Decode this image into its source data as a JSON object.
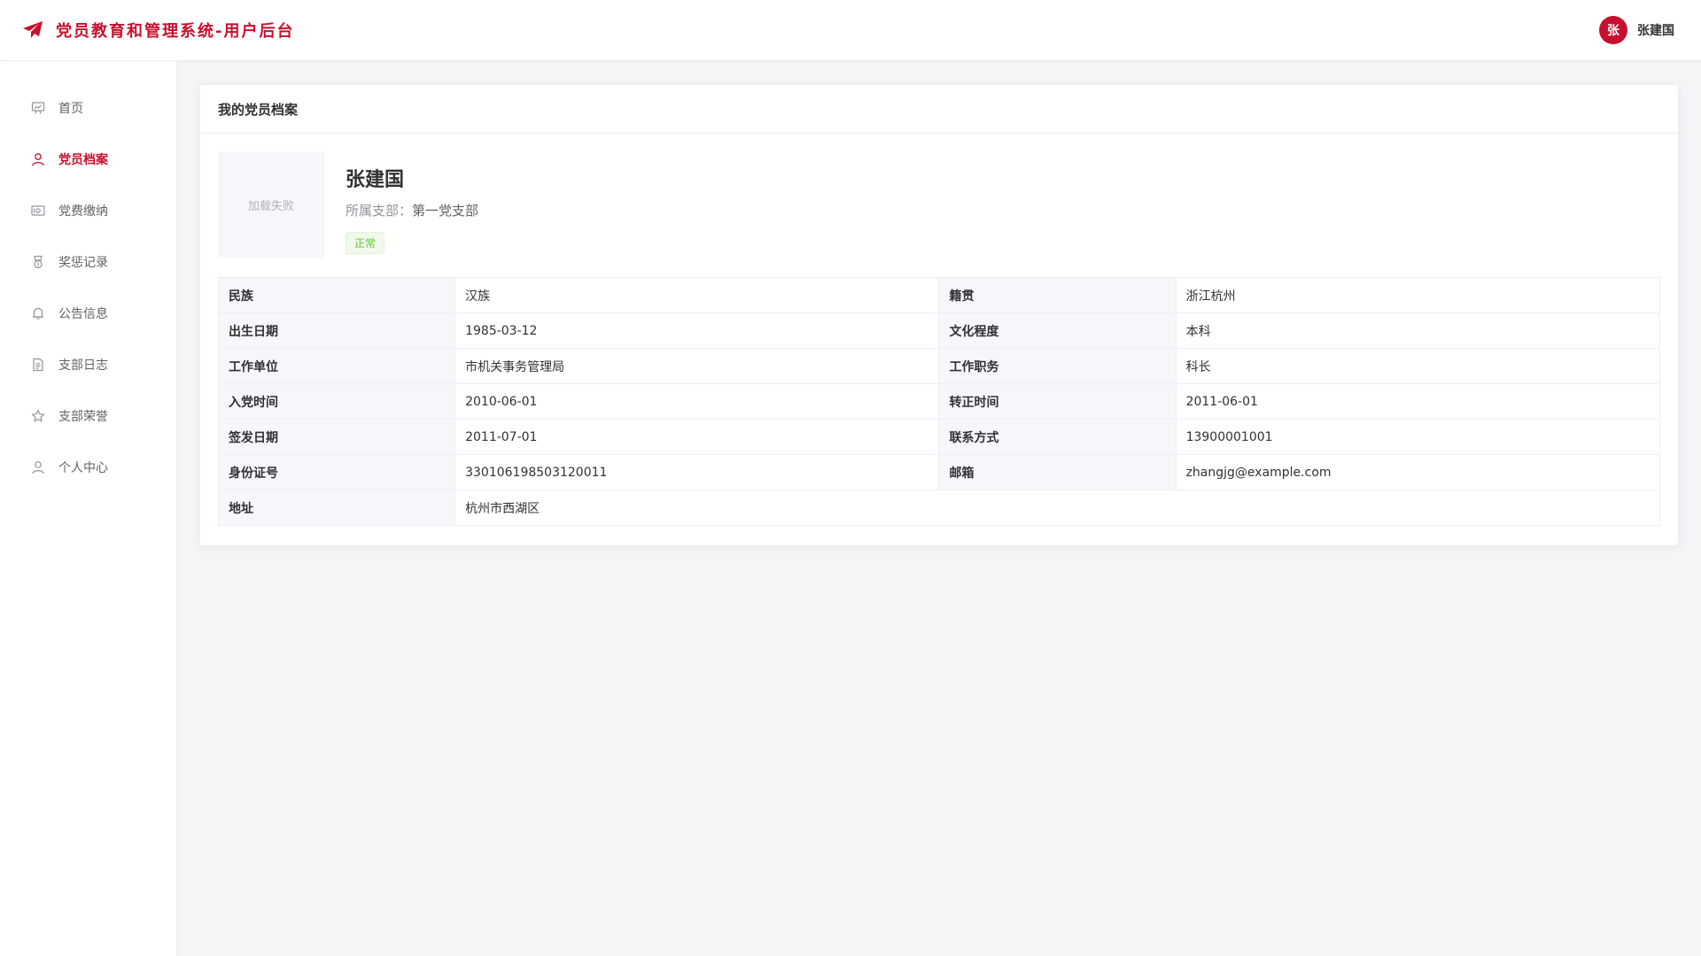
{
  "header": {
    "title": "党员教育和管理系统-用户后台",
    "avatar_text": "张",
    "user_name": "张建国",
    "brand_color": "#c8102e"
  },
  "sidebar": {
    "items": [
      {
        "label": "首页",
        "icon": "presentation-icon",
        "active": false
      },
      {
        "label": "党员档案",
        "icon": "user-icon",
        "active": true
      },
      {
        "label": "党费缴纳",
        "icon": "money-icon",
        "active": false
      },
      {
        "label": "奖惩记录",
        "icon": "medal-icon",
        "active": false
      },
      {
        "label": "公告信息",
        "icon": "bell-icon",
        "active": false
      },
      {
        "label": "支部日志",
        "icon": "document-icon",
        "active": false
      },
      {
        "label": "支部荣誉",
        "icon": "star-icon",
        "active": false
      },
      {
        "label": "个人中心",
        "icon": "user-icon",
        "active": false
      }
    ]
  },
  "card": {
    "title": "我的党员档案",
    "photo_placeholder": "加载失败",
    "name": "张建国",
    "branch_label": "所属支部：",
    "branch_value": "第一党支部",
    "status": "正常",
    "rows": [
      {
        "k1": "民族",
        "v1": "汉族",
        "k2": "籍贯",
        "v2": "浙江杭州"
      },
      {
        "k1": "出生日期",
        "v1": "1985-03-12",
        "k2": "文化程度",
        "v2": "本科"
      },
      {
        "k1": "工作单位",
        "v1": "市机关事务管理局",
        "k2": "工作职务",
        "v2": "科长"
      },
      {
        "k1": "入党时间",
        "v1": "2010-06-01",
        "k2": "转正时间",
        "v2": "2011-06-01"
      },
      {
        "k1": "签发日期",
        "v1": "2011-07-01",
        "k2": "联系方式",
        "v2": "13900001001"
      },
      {
        "k1": "身份证号",
        "v1": "330106198503120011",
        "k2": "邮箱",
        "v2": "zhangjg@example.com"
      }
    ],
    "address": {
      "k": "地址",
      "v": "杭州市西湖区"
    }
  }
}
